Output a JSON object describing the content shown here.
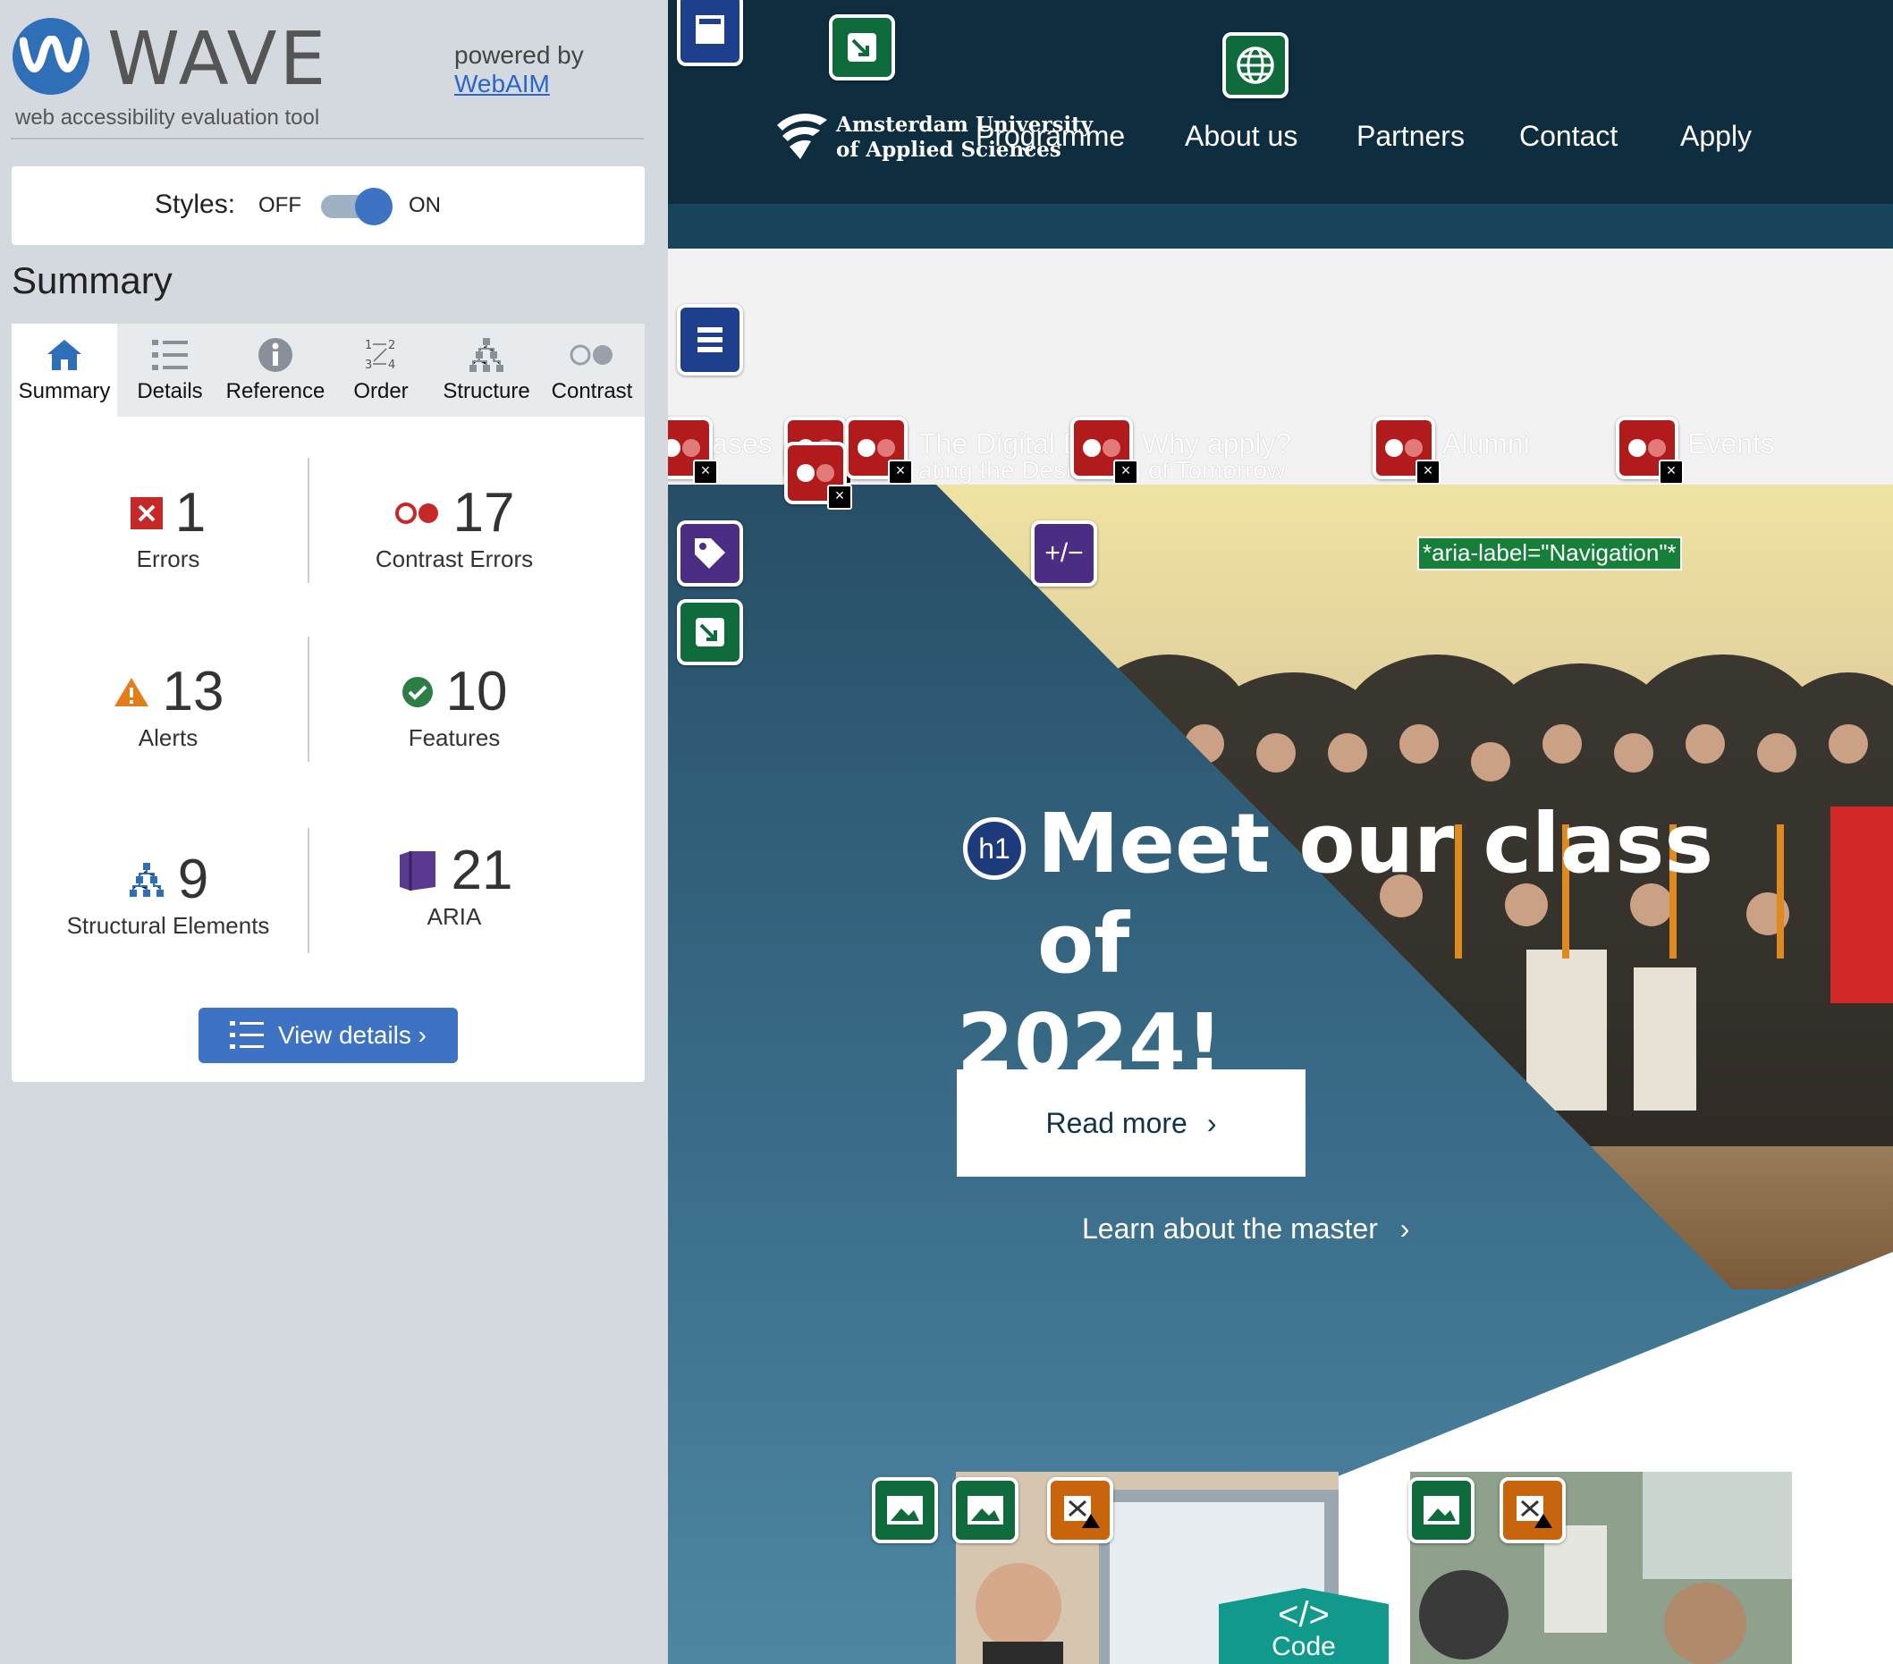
{
  "wave": {
    "title": "WAVE",
    "subtitle": "web accessibility evaluation tool",
    "powered_by": "powered by",
    "webaim_link": "WebAIM",
    "styles_label": "Styles:",
    "off_label": "OFF",
    "on_label": "ON",
    "styles_on": true,
    "summary_heading": "Summary",
    "tabs": [
      {
        "label": "Summary",
        "icon": "home-icon",
        "active": true
      },
      {
        "label": "Details",
        "icon": "list-icon",
        "active": false
      },
      {
        "label": "Reference",
        "icon": "info-icon",
        "active": false
      },
      {
        "label": "Order",
        "icon": "order-icon",
        "active": false
      },
      {
        "label": "Structure",
        "icon": "structure-icon",
        "active": false
      },
      {
        "label": "Contrast",
        "icon": "contrast-icon",
        "active": false
      }
    ],
    "stats": {
      "errors": {
        "value": "1",
        "label": "Errors"
      },
      "contrast": {
        "value": "17",
        "label": "Contrast Errors"
      },
      "alerts": {
        "value": "13",
        "label": "Alerts"
      },
      "features": {
        "value": "10",
        "label": "Features"
      },
      "structural": {
        "value": "9",
        "label": "Structural Elements"
      },
      "aria": {
        "value": "21",
        "label": "ARIA"
      }
    },
    "view_details": "View details ›"
  },
  "site": {
    "brand_line1": "Amsterdam University",
    "brand_line2": "of Applied Sciences",
    "nav": [
      "Programme",
      "About us",
      "Partners",
      "Contact",
      "Apply"
    ],
    "menu": [
      "Cases",
      "The Digital D",
      "Why apply?",
      "Alumni",
      "Events"
    ],
    "menu_sub": "ating the Desi      aders of Tomorrow",
    "aria_label": "*aria-label=\"Navigation\"*",
    "expand_label": "+/−",
    "h1_badge": "h1",
    "hero_title_line1": "Meet our class of",
    "hero_title_line2": "2024!",
    "read_more": "Read more",
    "learn_more": "Learn about the master",
    "chevron": "›",
    "code_label": "Code",
    "code_symbol": "</>"
  },
  "colors": {
    "wave_blue": "#3e72c2",
    "site_dark": "#0e2e40",
    "hero_blue": "#3b6f8c",
    "error_red": "#b21b1b",
    "feature_green": "#0f6b3b",
    "aria_purple": "#4b2e83",
    "alert_orange": "#c8650c"
  }
}
